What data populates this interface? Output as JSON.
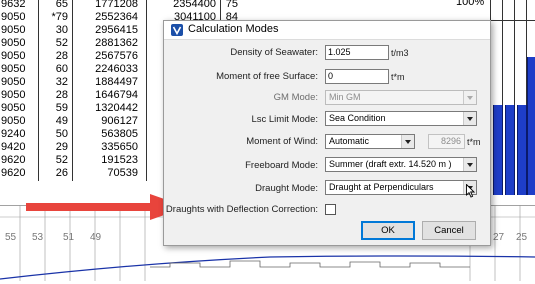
{
  "background_table": {
    "rows": [
      [
        "9632",
        "65",
        "1771208",
        "2354400",
        "75"
      ],
      [
        "9050",
        "*79",
        "2552364",
        "3041100",
        "84"
      ],
      [
        "9050",
        "30",
        "2956415",
        "",
        ""
      ],
      [
        "9050",
        "52",
        "2881362",
        "",
        ""
      ],
      [
        "9050",
        "28",
        "2567576",
        "",
        ""
      ],
      [
        "9050",
        "60",
        "2246033",
        "",
        ""
      ],
      [
        "9050",
        "32",
        "1884497",
        "",
        ""
      ],
      [
        "9050",
        "28",
        "1646794",
        "",
        ""
      ],
      [
        "9050",
        "59",
        "1320442",
        "",
        ""
      ],
      [
        "9050",
        "49",
        "906127",
        "",
        ""
      ],
      [
        "9240",
        "50",
        "563805",
        "",
        ""
      ],
      [
        "9420",
        "29",
        "335650",
        "",
        ""
      ],
      [
        "9620",
        "52",
        "191523",
        "",
        ""
      ],
      [
        "9620",
        "26",
        "70539",
        "",
        ""
      ]
    ],
    "corner_text": "100%"
  },
  "axis_labels": [
    "55",
    "53",
    "51",
    "49",
    "27",
    "25"
  ],
  "dialog": {
    "title": "Calculation Modes",
    "density_label": "Density of Seawater:",
    "density_value": "1.025",
    "density_unit": "t/m3",
    "moment_free_label": "Moment of free Surface:",
    "moment_free_value": "0",
    "moment_free_unit": "t*m",
    "gm_mode_label": "GM Mode:",
    "gm_mode_value": "Min GM",
    "lsc_label": "Lsc Limit Mode:",
    "lsc_value": "Sea Condition",
    "moment_wind_label": "Moment of Wind:",
    "moment_wind_value": "Automatic",
    "moment_wind_number": "8296",
    "moment_wind_unit": "t*m",
    "freeboard_label": "Freeboard Mode:",
    "freeboard_value": "Summer (draft extr. 14.520 m )",
    "draught_label": "Draught Mode:",
    "draught_value": "Draught at Perpendiculars",
    "deflection_label": "Draughts with Deflection Correction:",
    "deflection_checked": false,
    "ok_label": "OK",
    "cancel_label": "Cancel"
  },
  "colors": {
    "annotation_arrow": "#e8443c",
    "bars": "#1e3ec8",
    "default_button_border": "#0078d7"
  },
  "icons": {
    "title": "app-logo-icon",
    "dropdown": "chevron-down-icon",
    "pointer": "mouse-cursor-icon"
  }
}
